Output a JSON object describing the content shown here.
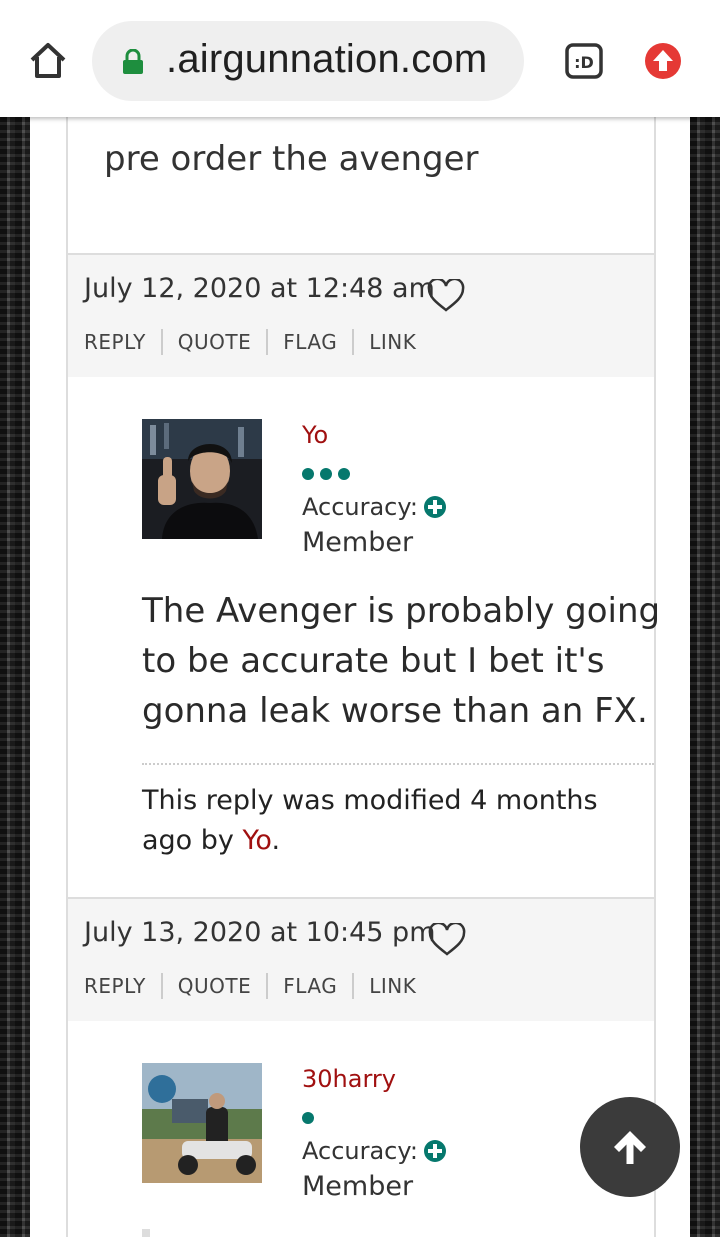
{
  "browser": {
    "url": ".airgunnation.com",
    "tab_label": ":D"
  },
  "posts": {
    "first_body": "pre order the avenger",
    "meta1": {
      "date": "July 12, 2020 at 12:48 am",
      "actions": [
        "REPLY",
        "QUOTE",
        "FLAG",
        "LINK"
      ]
    },
    "post2": {
      "author": "Yo",
      "rank_dots": 3,
      "accuracy_label": "Accuracy:",
      "role": "Member",
      "body": "The Avenger is probably going to be accurate but I bet it's gonna leak worse than an FX.",
      "mod_prefix": "This reply was modified 4 months ago by",
      "mod_name": "Yo",
      "mod_suffix": "."
    },
    "meta2": {
      "date": "July 13, 2020 at 10:45 pm",
      "actions": [
        "REPLY",
        "QUOTE",
        "FLAG",
        "LINK"
      ]
    },
    "post3": {
      "author": "30harry",
      "rank_dots": 1,
      "accuracy_label": "Accuracy:",
      "role": "Member"
    }
  },
  "colors": {
    "accent_name": "#a01010",
    "rank_dot": "#06786d",
    "lock": "#1e8e3e",
    "update": "#e53935"
  },
  "icons": [
    "home-icon",
    "lock-icon",
    "tab-switcher-icon",
    "update-icon",
    "heart-icon",
    "plus-icon",
    "arrow-up-icon"
  ]
}
